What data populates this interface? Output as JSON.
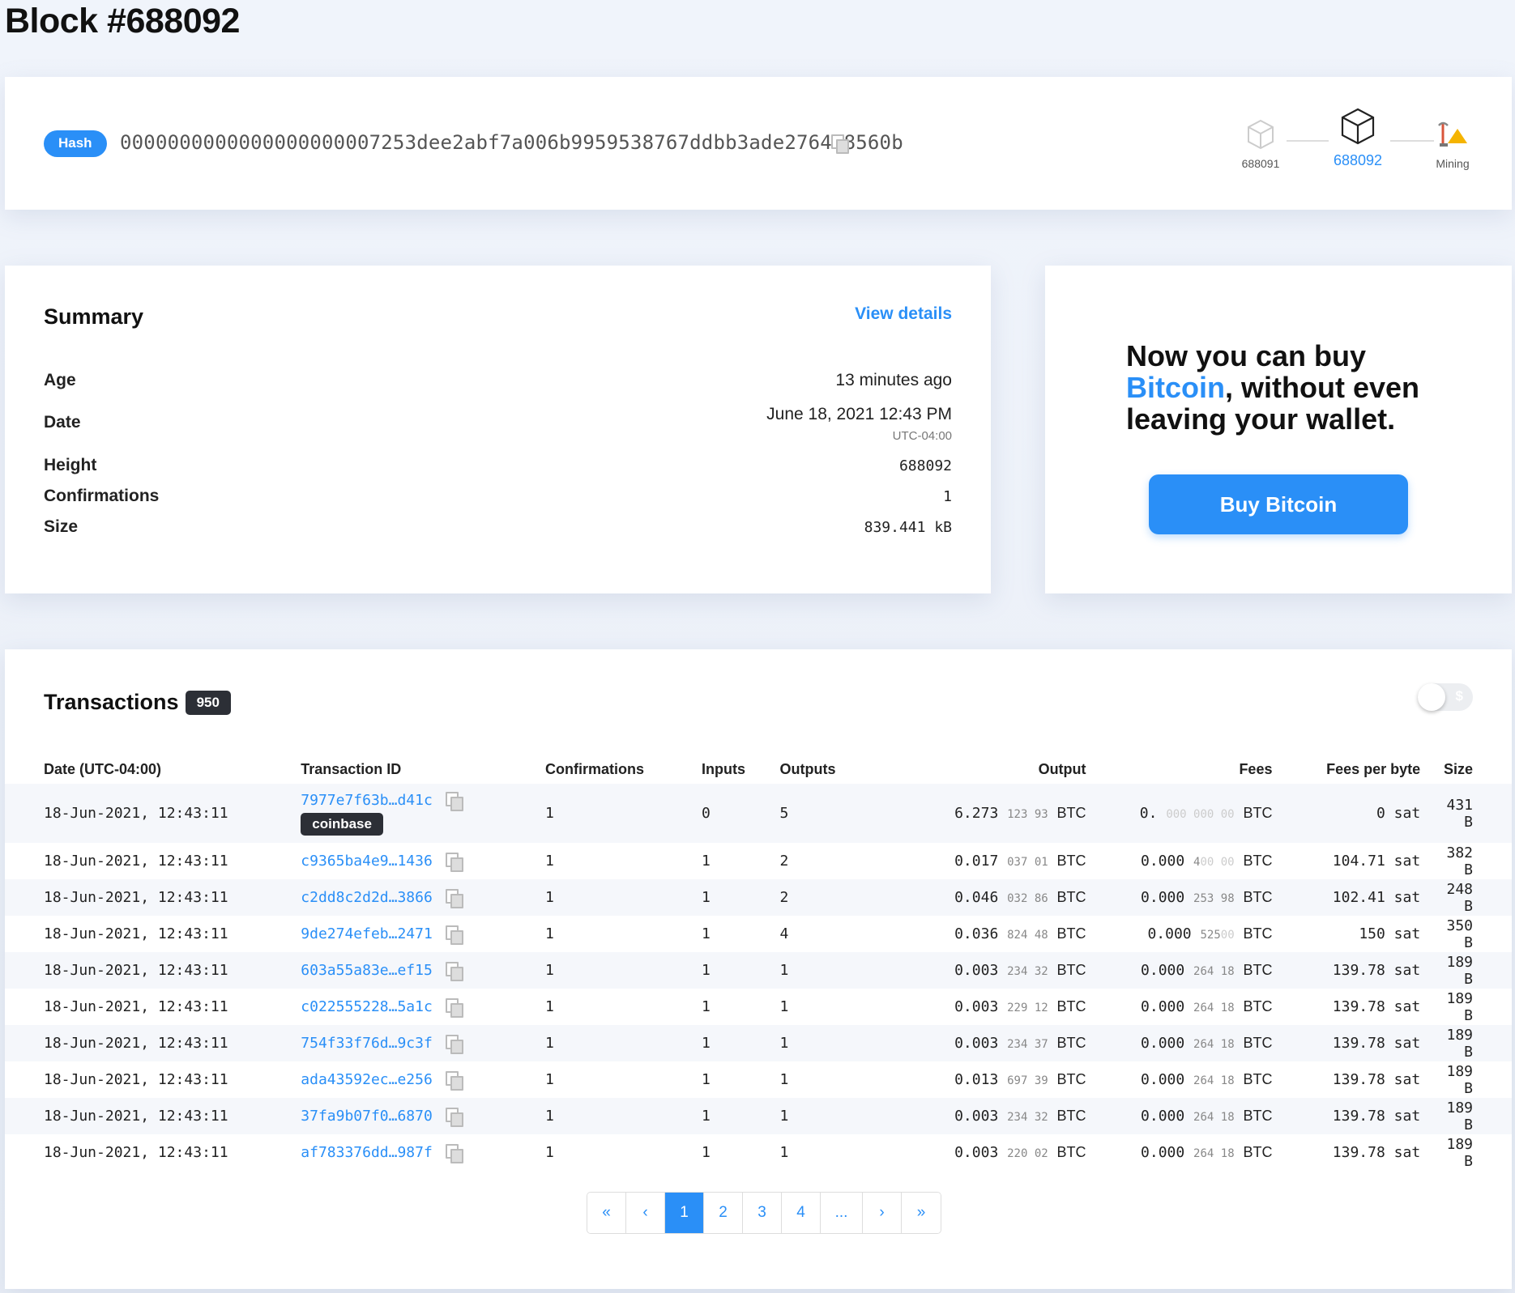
{
  "page": {
    "title": "Block #688092"
  },
  "hash": {
    "label": "Hash",
    "value": "0000000000000000000007253dee2abf7a006b9959538767ddbb3ade276478560b"
  },
  "block_nav": {
    "prev": "688091",
    "current": "688092",
    "next": "Mining"
  },
  "summary": {
    "title": "Summary",
    "view_details": "View details",
    "age_label": "Age",
    "age_value": "13 minutes ago",
    "date_label": "Date",
    "date_value": "June 18, 2021 12:43 PM",
    "date_tz": "UTC-04:00",
    "height_label": "Height",
    "height_value": "688092",
    "confirmations_label": "Confirmations",
    "confirmations_value": "1",
    "size_label": "Size",
    "size_value": "839.441 kB"
  },
  "promo": {
    "line1": "Now you can buy",
    "accent": "Bitcoin",
    "line2": ", without even",
    "line3": "leaving your wallet.",
    "button": "Buy Bitcoin"
  },
  "transactions": {
    "title": "Transactions",
    "count": "950",
    "toggle_symbol": "$",
    "columns": {
      "date": "Date (UTC-04:00)",
      "txid": "Transaction ID",
      "confirmations": "Confirmations",
      "inputs": "Inputs",
      "outputs": "Outputs",
      "output": "Output",
      "fees": "Fees",
      "fees_per_byte": "Fees per byte",
      "size": "Size"
    },
    "coinbase_badge": "coinbase",
    "btc_unit": "BTC",
    "rows": [
      {
        "date": "18-Jun-2021, 12:43:11",
        "txid": "7977e7f63b…d41c",
        "conf": "1",
        "inputs": "0",
        "outputs": "5",
        "out_main": "6.273",
        "out_small": "123 93",
        "out_small_faint": "",
        "fee_main": "0.",
        "fee_small": "",
        "fee_small_faint": "000 000 00",
        "fpb": "0 sat",
        "size": "431 B"
      },
      {
        "date": "18-Jun-2021, 12:43:11",
        "txid": "c9365ba4e9…1436",
        "conf": "1",
        "inputs": "1",
        "outputs": "2",
        "out_main": "0.017",
        "out_small": "037 01",
        "out_small_faint": "",
        "fee_main": "0.000",
        "fee_small": "4",
        "fee_small_faint": "00 00",
        "fpb": "104.71 sat",
        "size": "382 B"
      },
      {
        "date": "18-Jun-2021, 12:43:11",
        "txid": "c2dd8c2d2d…3866",
        "conf": "1",
        "inputs": "1",
        "outputs": "2",
        "out_main": "0.046",
        "out_small": "032 86",
        "out_small_faint": "",
        "fee_main": "0.000",
        "fee_small": "253 98",
        "fee_small_faint": "",
        "fpb": "102.41 sat",
        "size": "248 B"
      },
      {
        "date": "18-Jun-2021, 12:43:11",
        "txid": "9de274efeb…2471",
        "conf": "1",
        "inputs": "1",
        "outputs": "4",
        "out_main": "0.036",
        "out_small": "824 48",
        "out_small_faint": "",
        "fee_main": "0.000",
        "fee_small": "525",
        "fee_small_faint": "00",
        "fpb": "150 sat",
        "size": "350 B"
      },
      {
        "date": "18-Jun-2021, 12:43:11",
        "txid": "603a55a83e…ef15",
        "conf": "1",
        "inputs": "1",
        "outputs": "1",
        "out_main": "0.003",
        "out_small": "234 32",
        "out_small_faint": "",
        "fee_main": "0.000",
        "fee_small": "264 18",
        "fee_small_faint": "",
        "fpb": "139.78 sat",
        "size": "189 B"
      },
      {
        "date": "18-Jun-2021, 12:43:11",
        "txid": "c022555228…5a1c",
        "conf": "1",
        "inputs": "1",
        "outputs": "1",
        "out_main": "0.003",
        "out_small": "229 12",
        "out_small_faint": "",
        "fee_main": "0.000",
        "fee_small": "264 18",
        "fee_small_faint": "",
        "fpb": "139.78 sat",
        "size": "189 B"
      },
      {
        "date": "18-Jun-2021, 12:43:11",
        "txid": "754f33f76d…9c3f",
        "conf": "1",
        "inputs": "1",
        "outputs": "1",
        "out_main": "0.003",
        "out_small": "234 37",
        "out_small_faint": "",
        "fee_main": "0.000",
        "fee_small": "264 18",
        "fee_small_faint": "",
        "fpb": "139.78 sat",
        "size": "189 B"
      },
      {
        "date": "18-Jun-2021, 12:43:11",
        "txid": "ada43592ec…e256",
        "conf": "1",
        "inputs": "1",
        "outputs": "1",
        "out_main": "0.013",
        "out_small": "697 39",
        "out_small_faint": "",
        "fee_main": "0.000",
        "fee_small": "264 18",
        "fee_small_faint": "",
        "fpb": "139.78 sat",
        "size": "189 B"
      },
      {
        "date": "18-Jun-2021, 12:43:11",
        "txid": "37fa9b07f0…6870",
        "conf": "1",
        "inputs": "1",
        "outputs": "1",
        "out_main": "0.003",
        "out_small": "234 32",
        "out_small_faint": "",
        "fee_main": "0.000",
        "fee_small": "264 18",
        "fee_small_faint": "",
        "fpb": "139.78 sat",
        "size": "189 B"
      },
      {
        "date": "18-Jun-2021, 12:43:11",
        "txid": "af783376dd…987f",
        "conf": "1",
        "inputs": "1",
        "outputs": "1",
        "out_main": "0.003",
        "out_small": "220 02",
        "out_small_faint": "",
        "fee_main": "0.000",
        "fee_small": "264 18",
        "fee_small_faint": "",
        "fpb": "139.78 sat",
        "size": "189 B"
      }
    ]
  },
  "pagination": {
    "first": "«",
    "prev": "‹",
    "pages": [
      "1",
      "2",
      "3",
      "4"
    ],
    "ellipsis": "...",
    "next": "›",
    "last": "»",
    "active": "1"
  },
  "colors": {
    "accent": "#2a8ff7",
    "badge_dark": "#2c2f36",
    "mining_icon": "#f5b400"
  },
  "icons": {
    "copy": "copy-icon",
    "block": "cube-icon",
    "mining": "pickaxe-icon"
  }
}
